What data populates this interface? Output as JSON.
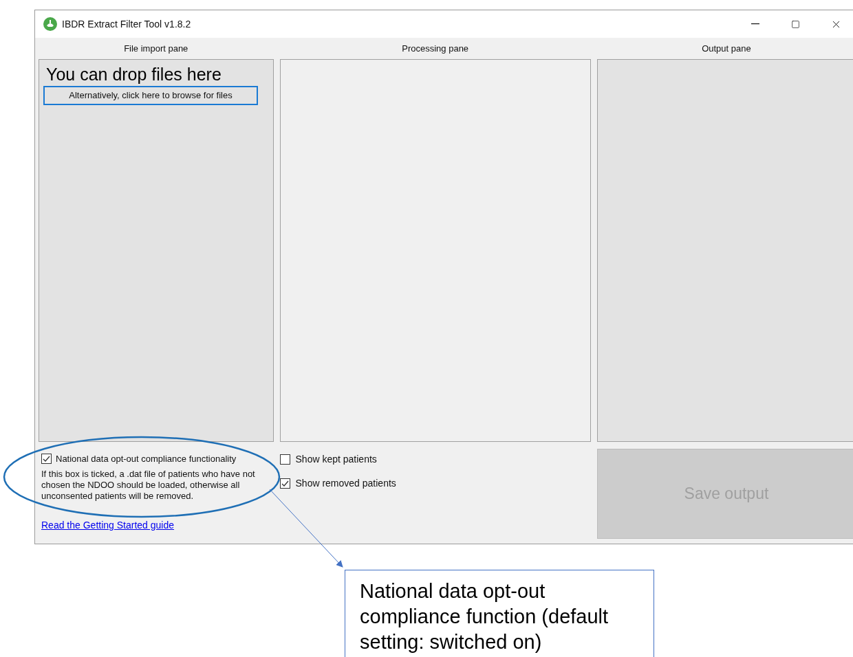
{
  "window": {
    "title": "IBDR Extract Filter Tool v1.8.2"
  },
  "panes": [
    {
      "heading": "File import pane"
    },
    {
      "heading": "Processing pane"
    },
    {
      "heading": "Output pane"
    }
  ],
  "drop_zone": {
    "heading": "You can drop files here",
    "browse_button": "Alternatively, click here to browse for files"
  },
  "opt_out": {
    "label": "National data opt-out compliance functionality",
    "checked": true,
    "description": "If this box is ticked, a .dat file of patients who have not chosen the NDOO should be loaded, otherwise all unconsented patients will be removed."
  },
  "display_options": [
    {
      "label": "Show kept patients",
      "checked": false
    },
    {
      "label": "Show removed patients",
      "checked": true
    }
  ],
  "guide_link": "Read the Getting Started guide",
  "save_button": {
    "label": "Save output",
    "disabled": true
  },
  "callout": {
    "text": "National data opt-out compliance function (default setting: switched on)"
  }
}
